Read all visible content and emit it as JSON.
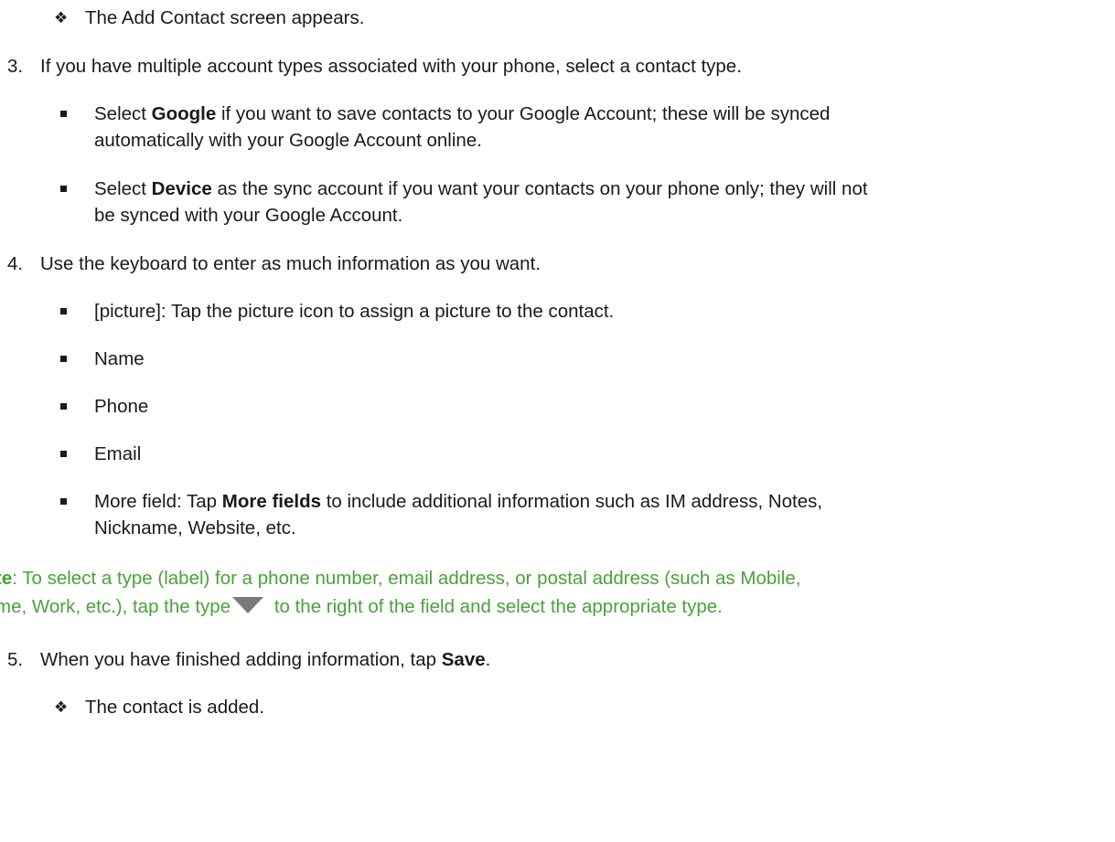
{
  "steps": {
    "add_contact_appears": "The Add Contact screen appears.",
    "step3": {
      "number": "3.",
      "text": "If you have multiple account types associated with your phone, select a contact type."
    },
    "google": {
      "pre": "Select ",
      "bold": "Google",
      "post": " if you want to save contacts to your Google Account; these will be synced",
      "line2": "automatically with your Google Account online."
    },
    "device": {
      "pre": "Select ",
      "bold": "Device",
      "post": " as the sync account if you want your contacts on your phone only; they will not",
      "line2": "be synced with your Google Account."
    },
    "step4": {
      "number": "4.",
      "text": "Use the keyboard to enter as much information as you want."
    },
    "fields": {
      "picture": "[picture]: Tap the picture icon to assign a picture to the contact.",
      "name": "Name",
      "phone": "Phone",
      "email": "Email",
      "more_pre": "More field: Tap ",
      "more_bold": "More fields",
      "more_post": " to include additional information such as IM address, Notes,",
      "more_line2": "Nickname, Website, etc."
    },
    "note": {
      "label": "te",
      "line1": ": To select a type (label) for a phone number, email address, or postal address (such as Mobile,",
      "line2_pre": "me, Work, etc.), tap the type",
      "line2_post": " to the right of the field and select the appropriate type.",
      "color": "#4aa13a",
      "icon": "dropdown-triangle-icon"
    },
    "step5": {
      "number": "5.",
      "pre": "When you have finished adding information, tap ",
      "bold": "Save",
      "post": "."
    },
    "contact_added": "The contact is added."
  }
}
